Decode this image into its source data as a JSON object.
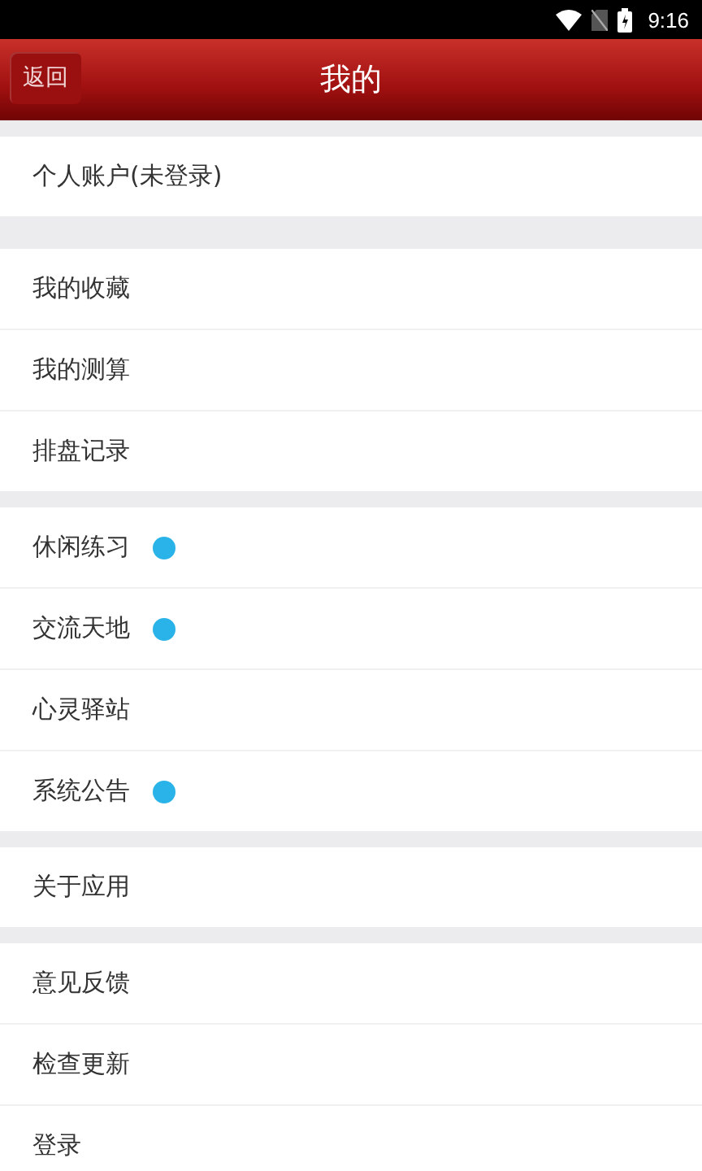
{
  "status_bar": {
    "time": "9:16"
  },
  "header": {
    "back_button": "返回",
    "title": "我的"
  },
  "sections": [
    {
      "items": [
        {
          "label": "个人账户(未登录)",
          "unread": false
        }
      ]
    },
    {
      "items": [
        {
          "label": "我的收藏",
          "unread": false
        },
        {
          "label": "我的测算",
          "unread": false
        },
        {
          "label": "排盘记录",
          "unread": false
        }
      ]
    },
    {
      "items": [
        {
          "label": "休闲练习",
          "unread": true
        },
        {
          "label": "交流天地",
          "unread": true
        },
        {
          "label": "心灵驿站",
          "unread": false
        },
        {
          "label": "系统公告",
          "unread": true
        }
      ]
    },
    {
      "items": [
        {
          "label": "关于应用",
          "unread": false
        }
      ]
    },
    {
      "items": [
        {
          "label": "意见反馈",
          "unread": false
        },
        {
          "label": "检查更新",
          "unread": false
        },
        {
          "label": "登录",
          "unread": false
        }
      ]
    }
  ]
}
